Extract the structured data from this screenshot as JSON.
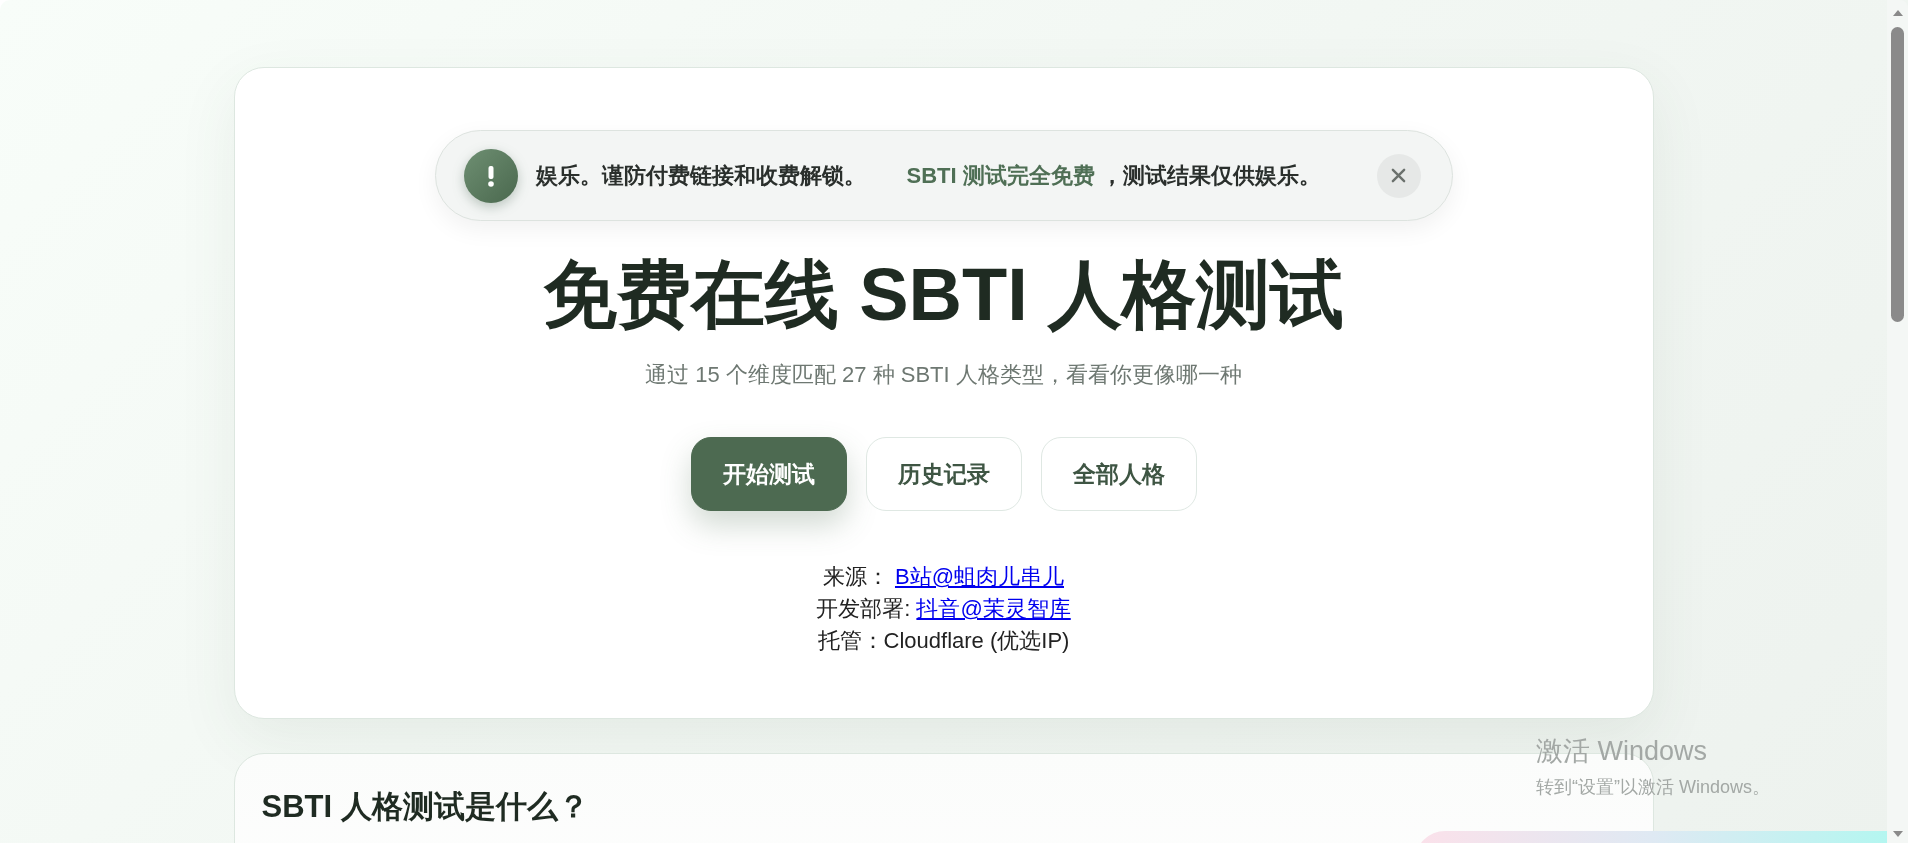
{
  "notice": {
    "messages": [
      {
        "parts": [
          {
            "text": "娱乐。谨防付费链接和收费解锁。",
            "highlight": false
          }
        ]
      },
      {
        "parts": [
          {
            "text": "SBTI 测试完全免费",
            "highlight": true
          },
          {
            "text": " ，测试结果仅供娱乐。",
            "highlight": false
          }
        ]
      }
    ]
  },
  "hero": {
    "title": "免费在线 SBTI 人格测试",
    "subtitle": "通过 15 个维度匹配 27 种 SBTI 人格类型，看看你更像哪一种",
    "buttons": [
      {
        "label": "开始测试",
        "kind": "primary"
      },
      {
        "label": "历史记录",
        "kind": "secondary"
      },
      {
        "label": "全部人格",
        "kind": "secondary"
      }
    ],
    "credits": [
      {
        "label": "来源：",
        "link": "B站@蛆肉儿串儿"
      },
      {
        "label": "开发部署:",
        "link": "抖音@茉灵智库"
      },
      {
        "text": "托管：Cloudflare (优选IP)"
      }
    ]
  },
  "section": {
    "title": "SBTI 人格测试是什么？"
  },
  "os_watermark": {
    "title": "激活 Windows",
    "subtitle": "转到“设置”以激活 Windows。"
  }
}
